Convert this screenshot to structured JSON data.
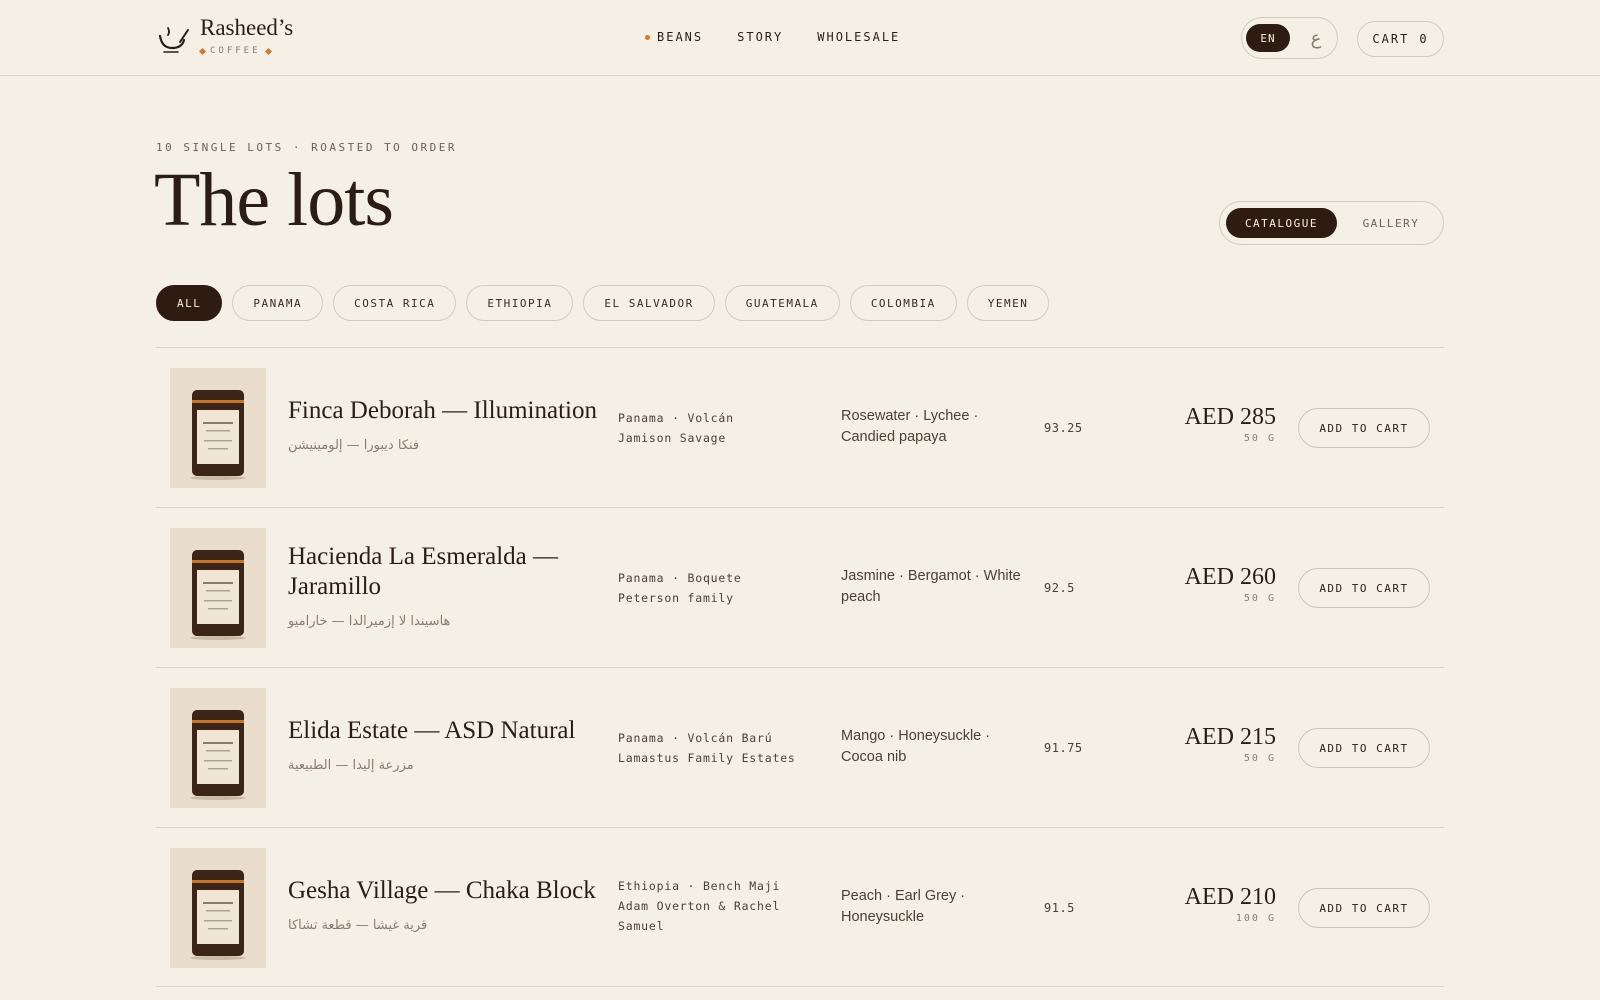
{
  "header": {
    "brand_name": "Rasheed’s",
    "brand_sub": "COFFEE",
    "nav": [
      {
        "label": "BEANS",
        "active": true
      },
      {
        "label": "STORY",
        "active": false
      },
      {
        "label": "WHOLESALE",
        "active": false
      }
    ],
    "lang_en": "EN",
    "lang_ar": "ع",
    "cart_label": "CART",
    "cart_count": "0"
  },
  "hero": {
    "eyebrow": "10 SINGLE LOTS · ROASTED TO ORDER",
    "title": "The lots",
    "view_catalogue": "CATALOGUE",
    "view_gallery": "GALLERY"
  },
  "filters": [
    "ALL",
    "PANAMA",
    "COSTA RICA",
    "ETHIOPIA",
    "EL SALVADOR",
    "GUATEMALA",
    "COLOMBIA",
    "YEMEN"
  ],
  "lots": [
    {
      "name": "Finca Deborah — Illumination",
      "name_ar": "فنكا ديبورا — إلومينيشن",
      "origin_line1": "Panama · Volcán",
      "origin_line2": "Jamison Savage",
      "origin_line3": "",
      "notes": "Rosewater · Lychee · Candied papaya",
      "score": "93.25",
      "price": "AED 285",
      "weight": "50 G",
      "cta": "ADD TO CART"
    },
    {
      "name": "Hacienda La Esmeralda — Jaramillo",
      "name_ar": "هاسيندا لا إزميرالدا — خاراميو",
      "origin_line1": "Panama · Boquete",
      "origin_line2": "Peterson family",
      "origin_line3": "",
      "notes": "Jasmine · Bergamot · White peach",
      "score": "92.5",
      "price": "AED 260",
      "weight": "50 G",
      "cta": "ADD TO CART"
    },
    {
      "name": "Elida Estate — ASD Natural",
      "name_ar": "مزرعة إليدا — الطبيعية",
      "origin_line1": "Panama · Volcán Barú",
      "origin_line2": "Lamastus Family Estates",
      "origin_line3": "",
      "notes": "Mango · Honeysuckle · Cocoa nib",
      "score": "91.75",
      "price": "AED 215",
      "weight": "50 G",
      "cta": "ADD TO CART"
    },
    {
      "name": "Gesha Village — Chaka Block",
      "name_ar": "قرية غيشا — قطعة تشاكا",
      "origin_line1": "Ethiopia · Bench Maji",
      "origin_line2": "Adam Overton & Rachel",
      "origin_line3": "Samuel",
      "notes": "Peach · Earl Grey · Honeysuckle",
      "score": "91.5",
      "price": "AED 210",
      "weight": "100 G",
      "cta": "ADD TO CART"
    }
  ],
  "colors": {
    "background": "#f5f0e6",
    "ink": "#2b1d14",
    "accent": "#d27a2e",
    "pill_dark": "#2e1c12"
  }
}
